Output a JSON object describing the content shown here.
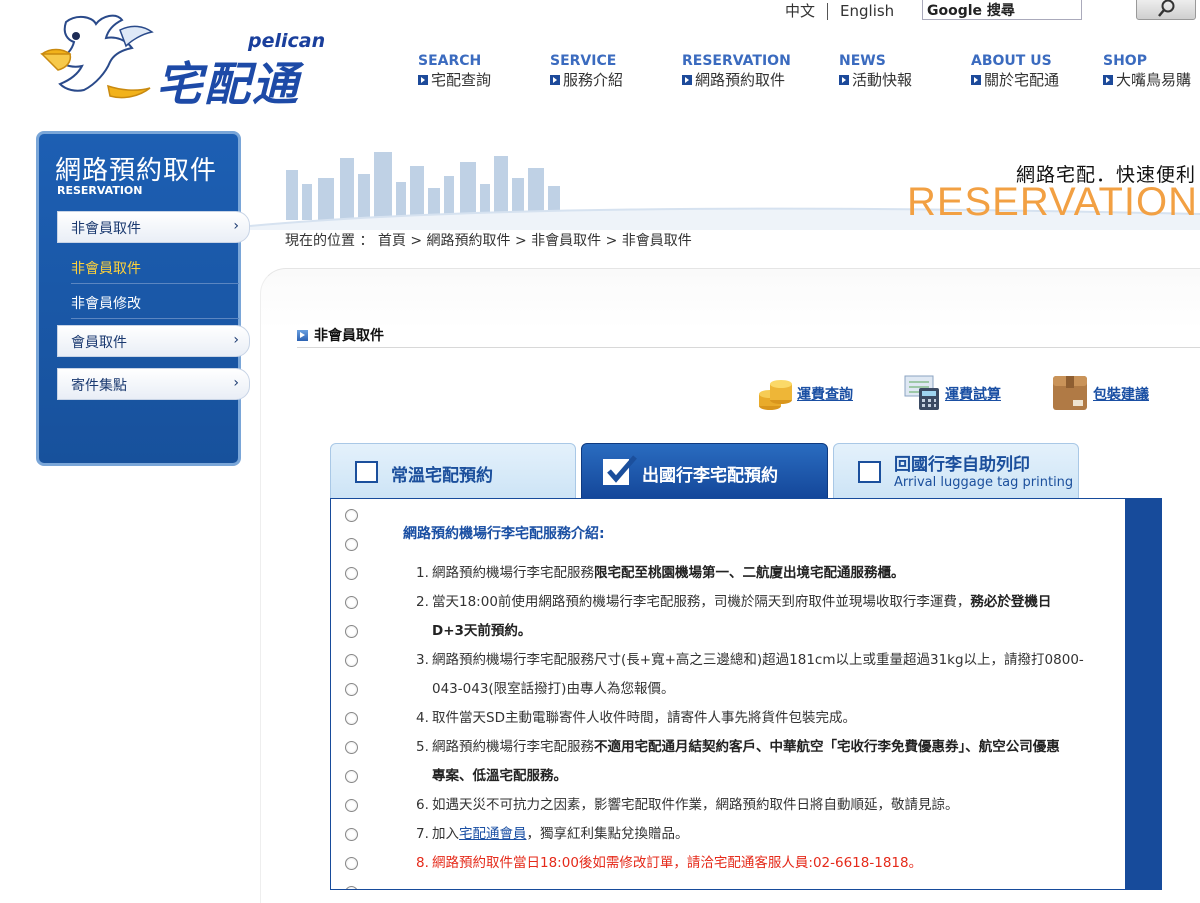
{
  "header": {
    "logo_text": "pelican",
    "brand_name": "宅配通",
    "lang_zh": "中文",
    "lang_en": "English",
    "search_placeholder": "Google 搜尋"
  },
  "nav": [
    {
      "en": "SEARCH",
      "zh": "宅配查詢"
    },
    {
      "en": "SERVICE",
      "zh": "服務介紹"
    },
    {
      "en": "RESERVATION",
      "zh": "網路預約取件"
    },
    {
      "en": "NEWS",
      "zh": "活動快報"
    },
    {
      "en": "ABOUT US",
      "zh": "關於宅配通"
    },
    {
      "en": "SHOP",
      "zh": "大嘴鳥易購"
    }
  ],
  "sidebar": {
    "title": "網路預約取件",
    "subtitle": "RESERVATION",
    "btn_nonmember": "非會員取件",
    "sub_active": "非會員取件",
    "sub_modify": "非會員修改",
    "btn_member": "會員取件",
    "btn_points": "寄件集點",
    "arrow": "›"
  },
  "banner": {
    "tagline": "網路宅配．快速便利",
    "big_word": "RESERVATION"
  },
  "breadcrumb": "現在的位置 ： 首頁 > 網路預約取件 > 非會員取件 > 非會員取件",
  "section_title": "非會員取件",
  "tools": {
    "rate_lookup": "運費查詢",
    "rate_calc": "運費試算",
    "packing": "包裝建議"
  },
  "tabs": {
    "normal": "常溫宅配預約",
    "outbound": "出國行李宅配預約",
    "inbound_zh": "回國行李自助列印",
    "inbound_en": "Arrival luggage tag printing"
  },
  "notice": {
    "title": "網路預約機場行李宅配服務介紹:",
    "i1_a": "網路預約機場行李宅配服務",
    "i1_b": "限宅配至桃園機場第一、二航廈出境宅配通服務櫃。",
    "i2_a": "當天18:00前使用網路預約機場行李宅配服務，司機於隔天到府取件並現場收取行李運費，",
    "i2_b": "務必於登機日",
    "i2_c": "D+3天前預約。",
    "i3_a": "網路預約機場行李宅配服務尺寸(長+寬+高之三邊總和)超過181cm以上或重量超過31kg以上，請撥打0800-",
    "i3_b": "043-043(限室話撥打)由專人為您報價。",
    "i4": "取件當天SD主動電聯寄件人收件時間，請寄件人事先將貨件包裝完成。",
    "i5_a": "網路預約機場行李宅配服務",
    "i5_b": "不適用宅配通月結契約客戶、中華航空「宅收行李免費優惠券」、航空公司優惠",
    "i5_c": "專案、低溫宅配服務。",
    "i6": "如遇天災不可抗力之因素，影響宅配取件作業，網路預約取件日將自動順延，敬請見諒。",
    "i7_a": "加入",
    "i7_link": "宅配通會員",
    "i7_b": "，獨享紅利集點兌換贈品。",
    "i8": "網路預約取件當日18:00後如需修改訂單，請洽宅配通客服人員:02-6618-1818。",
    "n1": "1.",
    "n2": "2.",
    "n3": "3.",
    "n4": "4.",
    "n5": "5.",
    "n6": "6.",
    "n7": "7.",
    "n8": "8."
  },
  "colors": {
    "brand_blue": "#1d4aa7",
    "nav_en": "#3b6bbf",
    "accent_orange": "#f2a043",
    "notice_red": "#e52a1a"
  }
}
